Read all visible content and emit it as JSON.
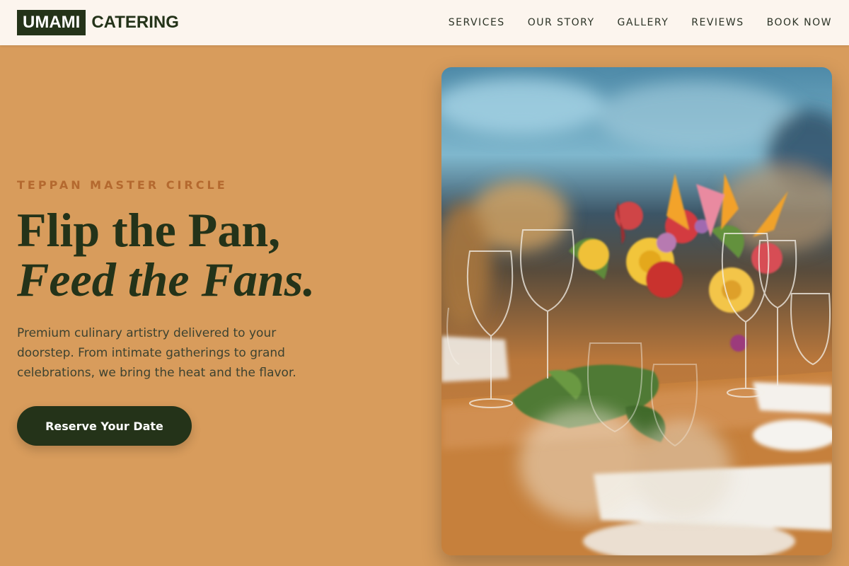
{
  "brand": {
    "logo_box": "UMAMI",
    "logo_word": "CATERING"
  },
  "nav": {
    "items": [
      {
        "label": "SERVICES"
      },
      {
        "label": "OUR STORY"
      },
      {
        "label": "GALLERY"
      },
      {
        "label": "REVIEWS"
      },
      {
        "label": "BOOK NOW"
      }
    ]
  },
  "hero": {
    "eyebrow": "TEPPAN MASTER CIRCLE",
    "headline_line1": "Flip the Pan,",
    "headline_line2": "Feed the Fans.",
    "description": "Premium culinary artistry delivered to your doorstep. From intimate gatherings to grand celebrations, we bring the heat and the flavor.",
    "cta_label": "Reserve Your Date"
  },
  "colors": {
    "background": "#d89c5c",
    "header_bg": "#fcf5ee",
    "brand_dark": "#243319",
    "eyebrow": "#b4692f"
  }
}
